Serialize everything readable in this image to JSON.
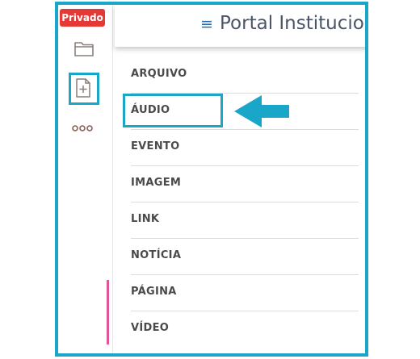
{
  "badge": {
    "label": "Privado",
    "color": "#e53935"
  },
  "header": {
    "title": "Portal Institucional",
    "menu_icon": "≡"
  },
  "sidebar": {
    "icons": [
      "folder-icon",
      "new-document-icon",
      "more-icon"
    ]
  },
  "menu": {
    "items": [
      {
        "label": "ARQUIVO"
      },
      {
        "label": "ÁUDIO"
      },
      {
        "label": "EVENTO"
      },
      {
        "label": "IMAGEM"
      },
      {
        "label": "LINK"
      },
      {
        "label": "NOTÍCIA"
      },
      {
        "label": "PÁGINA"
      },
      {
        "label": "VÍDEO"
      }
    ]
  },
  "colors": {
    "highlight": "#1aa6c8",
    "accent": "#e0559a",
    "menu_icon": "#2b6cb0"
  }
}
